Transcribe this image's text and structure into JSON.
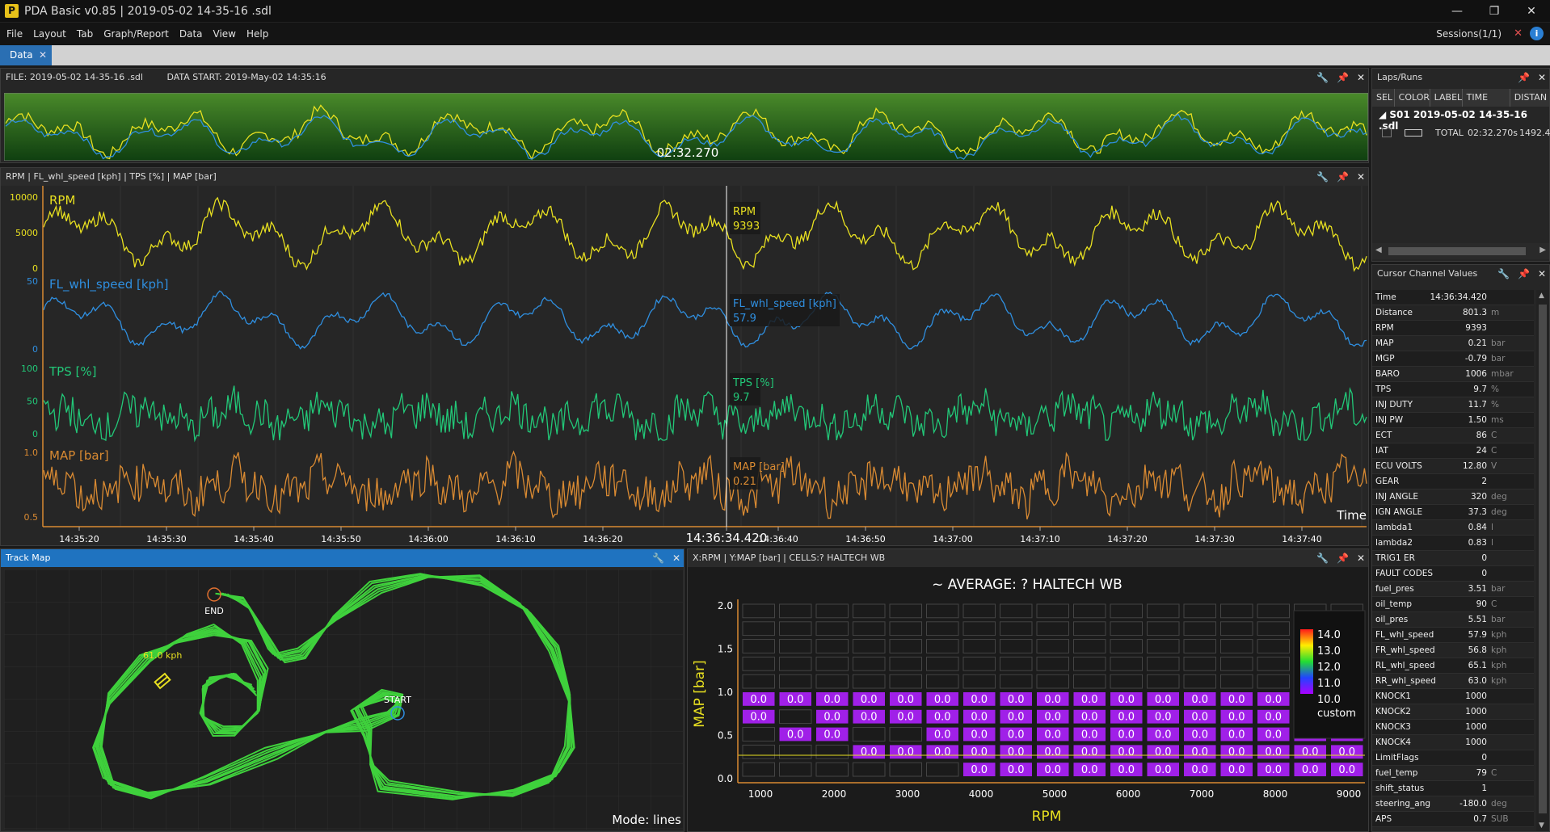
{
  "app": {
    "title": "PDA Basic v0.85  |  2019-05-02 14-35-16 .sdl",
    "icon_letter": "P",
    "window_controls": [
      "—",
      "❐",
      "✕"
    ]
  },
  "menu": {
    "items": [
      "File",
      "Layout",
      "Tab",
      "Graph/Report",
      "Data",
      "View",
      "Help"
    ],
    "sessions_label": "Sessions(1/1)"
  },
  "tabs": [
    {
      "label": "Data",
      "close": "✕"
    }
  ],
  "overview": {
    "file_label": "FILE: 2019-05-02 14-35-16 .sdl",
    "data_start_label": "DATA START: 2019-May-02  14:35:16",
    "duration": "02:32.270"
  },
  "graph": {
    "header": "RPM  |  FL_whl_speed [kph]  |  TPS [%]  |  MAP [bar]",
    "channels": [
      {
        "name": "RPM",
        "color": "#e8e020",
        "ticks": [
          "10000",
          "5000",
          "0"
        ],
        "cursor_label": "RPM",
        "cursor_value": "9393"
      },
      {
        "name": "FL_whl_speed [kph]",
        "color": "#2f8fe0",
        "ticks": [
          "50",
          "0"
        ],
        "cursor_label": "FL_whl_speed [kph]",
        "cursor_value": "57.9"
      },
      {
        "name": "TPS [%]",
        "color": "#22c878",
        "ticks": [
          "100",
          "50",
          "0"
        ],
        "cursor_label": "TPS [%]",
        "cursor_value": "9.7"
      },
      {
        "name": "MAP [bar]",
        "color": "#d98a32",
        "ticks": [
          "1.0",
          "0.5"
        ],
        "cursor_label": "MAP [bar]",
        "cursor_value": "0.21"
      }
    ],
    "time_ticks": [
      "14:35:20",
      "14:35:30",
      "14:35:40",
      "14:35:50",
      "14:36:00",
      "14:36:10",
      "14:36:20",
      "14:36:34.420",
      "14:36:40",
      "14:36:50",
      "14:37:00",
      "14:37:10",
      "14:37:20",
      "14:37:30",
      "14:37:40"
    ],
    "cursor_time": "14:36:34.420",
    "axis_label": "Time"
  },
  "track_map": {
    "title": "Track Map",
    "speed_label": "61.0 kph",
    "start_label": "START",
    "end_label": "END",
    "mode_label": "Mode: lines",
    "line_color": "#3fd13c"
  },
  "scatter": {
    "header": "X:RPM  |  Y:MAP [bar]  |  CELLS:? HALTECH WB",
    "title": "~ AVERAGE: ? HALTECH WB",
    "x_axis_label": "RPM",
    "y_axis_label": "MAP [bar]",
    "x_ticks": [
      "1000",
      "2000",
      "3000",
      "4000",
      "5000",
      "6000",
      "7000",
      "8000",
      "9000"
    ],
    "y_ticks": [
      "2.0",
      "1.5",
      "1.0",
      "0.5",
      "0.0"
    ],
    "cell_value": "0.0",
    "legend_values": [
      "14.0",
      "13.0",
      "12.0",
      "11.0",
      "10.0"
    ],
    "legend_custom": "custom",
    "filled_cell_color": "#a020e8"
  },
  "laps": {
    "title": "Laps/Runs",
    "columns": [
      "SEL",
      "COLOR",
      "LABEL",
      "TIME",
      "DISTAN"
    ],
    "session": "S01  2019-05-02 14-35-16 .sdl",
    "row": {
      "label": "TOTAL",
      "time": "02:32.270s",
      "distance": "1492.4"
    }
  },
  "cursor_values": {
    "title": "Cursor Channel Values",
    "rows": [
      {
        "name": "Time",
        "value": "14:36:34.420",
        "unit": ""
      },
      {
        "name": "Distance",
        "value": "801.3",
        "unit": "m"
      },
      {
        "name": "RPM",
        "value": "9393",
        "unit": ""
      },
      {
        "name": "MAP",
        "value": "0.21",
        "unit": "bar"
      },
      {
        "name": "MGP",
        "value": "-0.79",
        "unit": "bar"
      },
      {
        "name": "BARO",
        "value": "1006",
        "unit": "mbar"
      },
      {
        "name": "TPS",
        "value": "9.7",
        "unit": "%"
      },
      {
        "name": "INJ DUTY",
        "value": "11.7",
        "unit": "%"
      },
      {
        "name": "INJ PW",
        "value": "1.50",
        "unit": "ms"
      },
      {
        "name": "ECT",
        "value": "86",
        "unit": "C"
      },
      {
        "name": "IAT",
        "value": "24",
        "unit": "C"
      },
      {
        "name": "ECU VOLTS",
        "value": "12.80",
        "unit": "V"
      },
      {
        "name": "GEAR",
        "value": "2",
        "unit": ""
      },
      {
        "name": "INJ ANGLE",
        "value": "320",
        "unit": "deg"
      },
      {
        "name": "IGN ANGLE",
        "value": "37.3",
        "unit": "deg"
      },
      {
        "name": "lambda1",
        "value": "0.84",
        "unit": "l"
      },
      {
        "name": "lambda2",
        "value": "0.83",
        "unit": "l"
      },
      {
        "name": "TRIG1 ER",
        "value": "0",
        "unit": ""
      },
      {
        "name": "FAULT CODES",
        "value": "0",
        "unit": ""
      },
      {
        "name": "fuel_pres",
        "value": "3.51",
        "unit": "bar"
      },
      {
        "name": "oil_temp",
        "value": "90",
        "unit": "C"
      },
      {
        "name": "oil_pres",
        "value": "5.51",
        "unit": "bar"
      },
      {
        "name": "FL_whl_speed",
        "value": "57.9",
        "unit": "kph"
      },
      {
        "name": "FR_whl_speed",
        "value": "56.8",
        "unit": "kph"
      },
      {
        "name": "RL_whl_speed",
        "value": "65.1",
        "unit": "kph"
      },
      {
        "name": "RR_whl_speed",
        "value": "63.0",
        "unit": "kph"
      },
      {
        "name": "KNOCK1",
        "value": "1000",
        "unit": ""
      },
      {
        "name": "KNOCK2",
        "value": "1000",
        "unit": ""
      },
      {
        "name": "KNOCK3",
        "value": "1000",
        "unit": ""
      },
      {
        "name": "KNOCK4",
        "value": "1000",
        "unit": ""
      },
      {
        "name": "LimitFlags",
        "value": "0",
        "unit": ""
      },
      {
        "name": "fuel_temp",
        "value": "79",
        "unit": "C"
      },
      {
        "name": "shift_status",
        "value": "1",
        "unit": ""
      },
      {
        "name": "steering_ang",
        "value": "-180.0",
        "unit": "deg"
      },
      {
        "name": "APS",
        "value": "0.7",
        "unit": "SUB"
      }
    ]
  }
}
